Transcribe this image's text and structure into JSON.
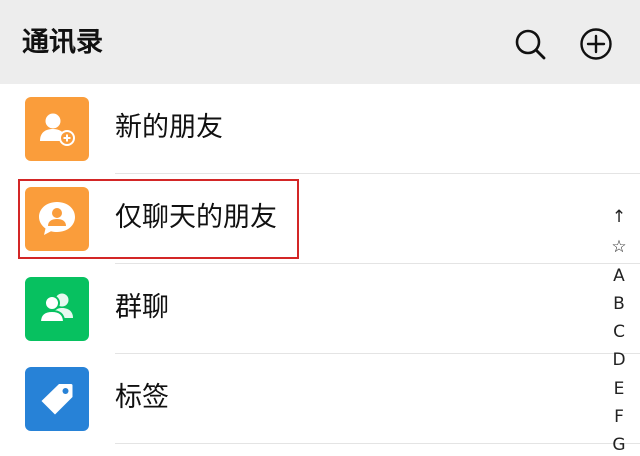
{
  "header": {
    "title": "通讯录",
    "search_icon": "search-icon",
    "add_icon": "plus-circle-icon",
    "background": "#ededed"
  },
  "contacts_menu": [
    {
      "label": "新的朋友",
      "icon": "add-friend-icon",
      "color": "#fa9d3b"
    },
    {
      "label": "仅聊天的朋友",
      "icon": "chat-only-friend-icon",
      "color": "#fa9d3b"
    },
    {
      "label": "群聊",
      "icon": "group-chat-icon",
      "color": "#07c160"
    },
    {
      "label": "标签",
      "icon": "tag-icon",
      "color": "#2782d7"
    }
  ],
  "highlight_color": "#d32626",
  "index_bar": [
    "↑",
    "☆",
    "A",
    "B",
    "C",
    "D",
    "E",
    "F",
    "G"
  ]
}
